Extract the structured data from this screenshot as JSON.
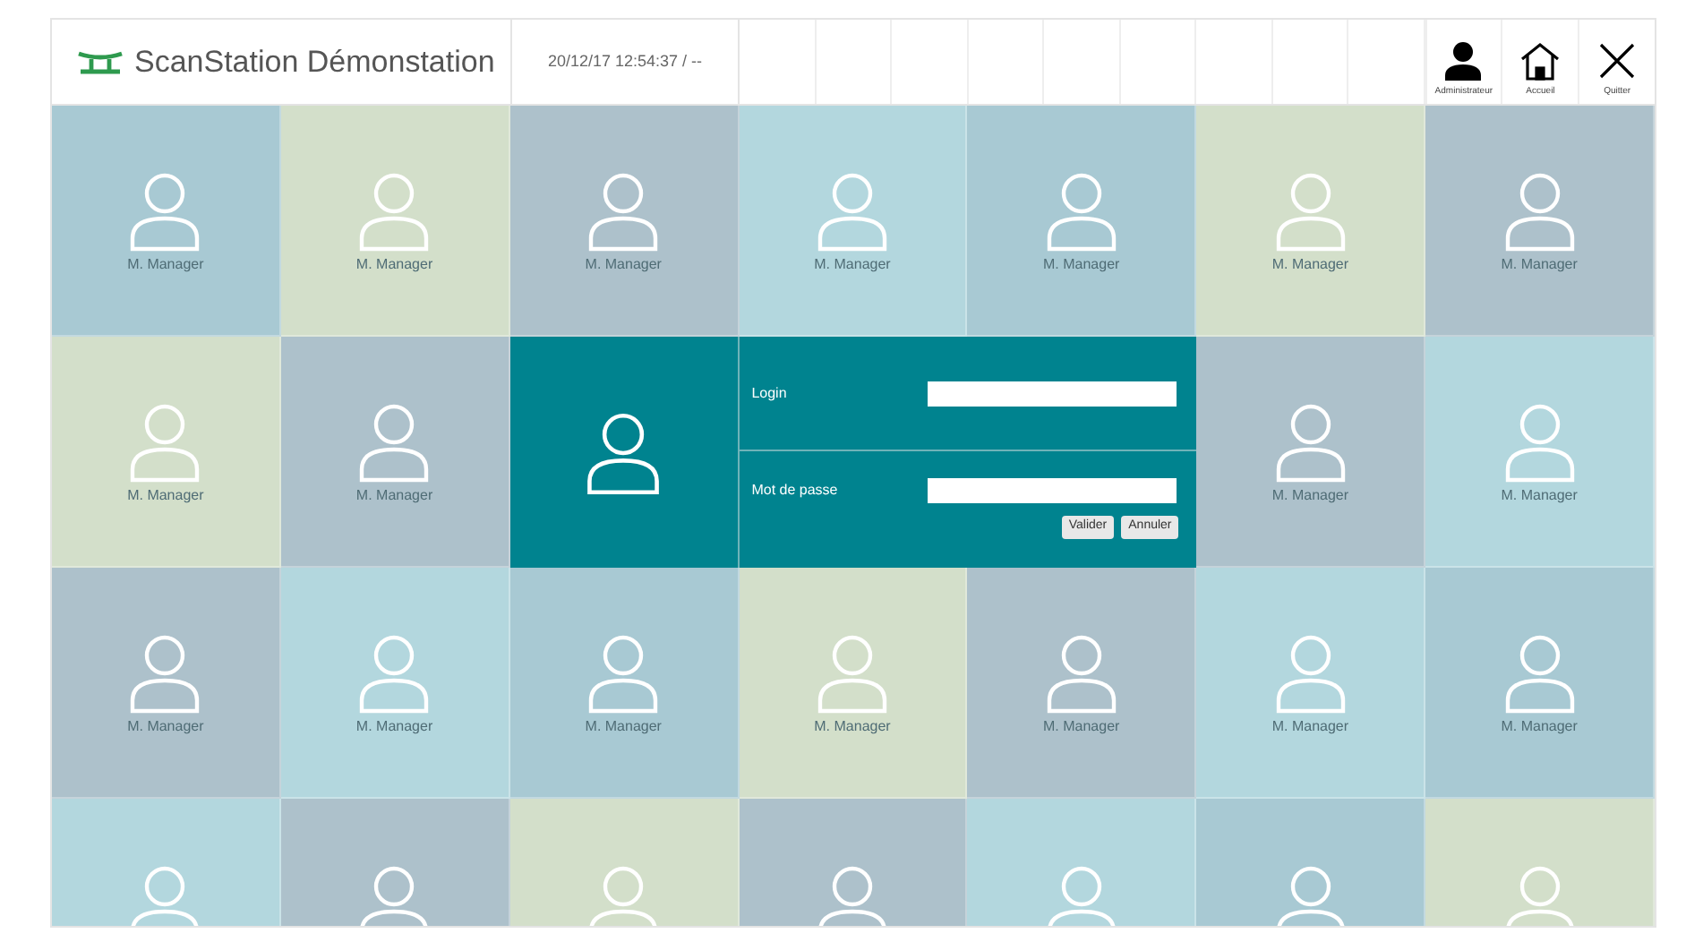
{
  "header": {
    "title": "ScanStation Démonstation",
    "datetime": "20/12/17 12:54:37 / --",
    "actions": [
      {
        "kind": "user",
        "label": "Administrateur"
      },
      {
        "kind": "home",
        "label": "Accueil"
      },
      {
        "kind": "close",
        "label": "Quitter"
      }
    ]
  },
  "rows": [
    [
      {
        "kind": "user",
        "name": "M. Manager",
        "color": "#a8c9d3"
      },
      {
        "kind": "user",
        "name": "M. Manager",
        "color": "#d3dfca"
      },
      {
        "kind": "user",
        "name": "M. Manager",
        "color": "#adc1cb"
      },
      {
        "kind": "user",
        "name": "M. Manager",
        "color": "#b3d7de"
      },
      {
        "kind": "user",
        "name": "M. Manager",
        "color": "#a8c9d3"
      },
      {
        "kind": "user",
        "name": "M. Manager",
        "color": "#d3dfca"
      },
      {
        "kind": "user",
        "name": "M. Manager",
        "color": "#adc1cb"
      }
    ],
    [
      {
        "kind": "user",
        "name": "M. Manager",
        "color": "#d3dfca"
      },
      {
        "kind": "user",
        "name": "M. Manager",
        "color": "#adc1cb"
      },
      {
        "kind": "login",
        "color": "#00838f",
        "login_label": "Login",
        "password_label": "Mot de passe",
        "buttons": [
          "Valider",
          "Annuler"
        ]
      },
      {
        "kind": "user",
        "name": "M. Manager",
        "color": "#adc1cb"
      },
      {
        "kind": "user",
        "name": "M. Manager",
        "color": "#b3d7de"
      }
    ],
    [
      {
        "kind": "user",
        "name": "M. Manager",
        "color": "#adc1cb"
      },
      {
        "kind": "user",
        "name": "M. Manager",
        "color": "#b3d7de"
      },
      {
        "kind": "user",
        "name": "M. Manager",
        "color": "#a8c9d3"
      },
      {
        "kind": "user",
        "name": "M. Manager",
        "color": "#d3dfca"
      },
      {
        "kind": "user",
        "name": "M. Manager",
        "color": "#adc1cb"
      },
      {
        "kind": "user",
        "name": "M. Manager",
        "color": "#b3d7de"
      },
      {
        "kind": "user",
        "name": "M. Manager",
        "color": "#a8c9d3"
      }
    ],
    [
      {
        "kind": "user",
        "color": "#b3d7de"
      },
      {
        "kind": "user",
        "color": "#adc1cb"
      },
      {
        "kind": "user",
        "color": "#d3dfca"
      },
      {
        "kind": "user",
        "color": "#adc1cb"
      },
      {
        "kind": "user",
        "color": "#b3d7de"
      },
      {
        "kind": "user",
        "color": "#a8c9d3"
      },
      {
        "kind": "user",
        "color": "#d3dfca"
      }
    ]
  ]
}
